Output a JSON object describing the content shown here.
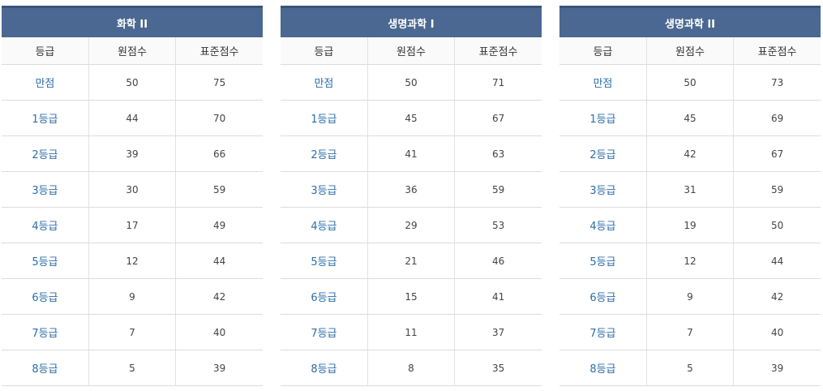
{
  "headers": [
    "등급",
    "원점수",
    "표준점수"
  ],
  "panels": [
    {
      "title": "화학 II",
      "rows": [
        [
          "만점",
          "50",
          "75"
        ],
        [
          "1등급",
          "44",
          "70"
        ],
        [
          "2등급",
          "39",
          "66"
        ],
        [
          "3등급",
          "30",
          "59"
        ],
        [
          "4등급",
          "17",
          "49"
        ],
        [
          "5등급",
          "12",
          "44"
        ],
        [
          "6등급",
          "9",
          "42"
        ],
        [
          "7등급",
          "7",
          "40"
        ],
        [
          "8등급",
          "5",
          "39"
        ]
      ]
    },
    {
      "title": "생명과학 I",
      "rows": [
        [
          "만점",
          "50",
          "71"
        ],
        [
          "1등급",
          "45",
          "67"
        ],
        [
          "2등급",
          "41",
          "63"
        ],
        [
          "3등급",
          "36",
          "59"
        ],
        [
          "4등급",
          "29",
          "53"
        ],
        [
          "5등급",
          "21",
          "46"
        ],
        [
          "6등급",
          "15",
          "41"
        ],
        [
          "7등급",
          "11",
          "37"
        ],
        [
          "8등급",
          "8",
          "35"
        ]
      ]
    },
    {
      "title": "생명과학 II",
      "rows": [
        [
          "만점",
          "50",
          "73"
        ],
        [
          "1등급",
          "45",
          "69"
        ],
        [
          "2등급",
          "42",
          "67"
        ],
        [
          "3등급",
          "31",
          "59"
        ],
        [
          "4등급",
          "19",
          "50"
        ],
        [
          "5등급",
          "12",
          "44"
        ],
        [
          "6등급",
          "9",
          "42"
        ],
        [
          "7등급",
          "7",
          "40"
        ],
        [
          "8등급",
          "5",
          "39"
        ]
      ]
    }
  ],
  "colors": {
    "header_bg": "#4a6891",
    "grade_text": "#2b6ea8"
  }
}
